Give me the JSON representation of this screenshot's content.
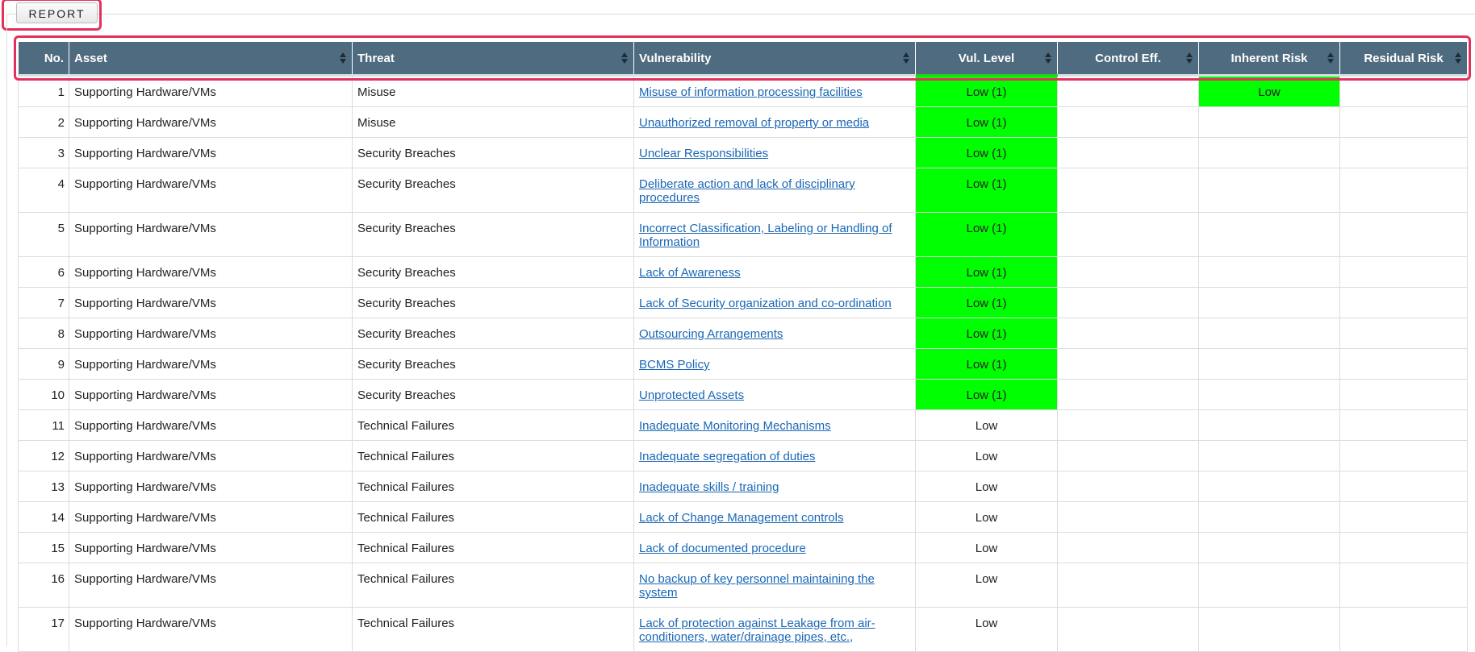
{
  "toolbar": {
    "report_label": "REPORT"
  },
  "table": {
    "headers": {
      "no": "No.",
      "asset": "Asset",
      "threat": "Threat",
      "vulnerability": "Vulnerability",
      "vul_level": "Vul. Level",
      "control_eff": "Control Eff.",
      "inherent_risk": "Inherent Risk",
      "residual_risk": "Residual Risk"
    },
    "colors": {
      "header_bg": "#4f6b7f",
      "level_low_bg": "#00ff00",
      "link": "#1a67b5",
      "highlight": "#e0325a"
    },
    "rows": [
      {
        "no": "1",
        "asset": "Supporting Hardware/VMs",
        "threat": "Misuse",
        "vulnerability": "Misuse of information processing facilities",
        "vul_level": "Low (1)",
        "control_eff": "",
        "inherent_risk": "Low",
        "residual_risk": ""
      },
      {
        "no": "2",
        "asset": "Supporting Hardware/VMs",
        "threat": "Misuse",
        "vulnerability": "Unauthorized removal of property or media",
        "vul_level": "Low (1)",
        "control_eff": "",
        "inherent_risk": "",
        "residual_risk": ""
      },
      {
        "no": "3",
        "asset": "Supporting Hardware/VMs",
        "threat": "Security Breaches",
        "vulnerability": "Unclear Responsibilities",
        "vul_level": "Low (1)",
        "control_eff": "",
        "inherent_risk": "",
        "residual_risk": ""
      },
      {
        "no": "4",
        "asset": "Supporting Hardware/VMs",
        "threat": "Security Breaches",
        "vulnerability": "Deliberate action and lack of disciplinary procedures",
        "vul_level": "Low (1)",
        "control_eff": "",
        "inherent_risk": "",
        "residual_risk": ""
      },
      {
        "no": "5",
        "asset": "Supporting Hardware/VMs",
        "threat": "Security Breaches",
        "vulnerability": "Incorrect Classification, Labeling or Handling of Information",
        "vul_level": "Low (1)",
        "control_eff": "",
        "inherent_risk": "",
        "residual_risk": ""
      },
      {
        "no": "6",
        "asset": "Supporting Hardware/VMs",
        "threat": "Security Breaches",
        "vulnerability": "Lack of Awareness",
        "vul_level": "Low (1)",
        "control_eff": "",
        "inherent_risk": "",
        "residual_risk": ""
      },
      {
        "no": "7",
        "asset": "Supporting Hardware/VMs",
        "threat": "Security Breaches",
        "vulnerability": "Lack of Security organization and co-ordination",
        "vul_level": "Low (1)",
        "control_eff": "",
        "inherent_risk": "",
        "residual_risk": ""
      },
      {
        "no": "8",
        "asset": "Supporting Hardware/VMs",
        "threat": "Security Breaches",
        "vulnerability": "Outsourcing Arrangements",
        "vul_level": "Low (1)",
        "control_eff": "",
        "inherent_risk": "",
        "residual_risk": ""
      },
      {
        "no": "9",
        "asset": "Supporting Hardware/VMs",
        "threat": "Security Breaches",
        "vulnerability": "BCMS Policy",
        "vul_level": "Low (1)",
        "control_eff": "",
        "inherent_risk": "",
        "residual_risk": ""
      },
      {
        "no": "10",
        "asset": "Supporting Hardware/VMs",
        "threat": "Security Breaches",
        "vulnerability": "Unprotected Assets",
        "vul_level": "Low (1)",
        "control_eff": "",
        "inherent_risk": "",
        "residual_risk": ""
      },
      {
        "no": "11",
        "asset": "Supporting Hardware/VMs",
        "threat": "Technical Failures",
        "vulnerability": "Inadequate Monitoring Mechanisms",
        "vul_level": "Low",
        "control_eff": "",
        "inherent_risk": "",
        "residual_risk": ""
      },
      {
        "no": "12",
        "asset": "Supporting Hardware/VMs",
        "threat": "Technical Failures",
        "vulnerability": "Inadequate segregation of duties",
        "vul_level": "Low",
        "control_eff": "",
        "inherent_risk": "",
        "residual_risk": ""
      },
      {
        "no": "13",
        "asset": "Supporting Hardware/VMs",
        "threat": "Technical Failures",
        "vulnerability": "Inadequate skills / training",
        "vul_level": "Low",
        "control_eff": "",
        "inherent_risk": "",
        "residual_risk": ""
      },
      {
        "no": "14",
        "asset": "Supporting Hardware/VMs",
        "threat": "Technical Failures",
        "vulnerability": "Lack of Change Management controls",
        "vul_level": "Low",
        "control_eff": "",
        "inherent_risk": "",
        "residual_risk": ""
      },
      {
        "no": "15",
        "asset": "Supporting Hardware/VMs",
        "threat": "Technical Failures",
        "vulnerability": "Lack of documented procedure",
        "vul_level": "Low",
        "control_eff": "",
        "inherent_risk": "",
        "residual_risk": ""
      },
      {
        "no": "16",
        "asset": "Supporting Hardware/VMs",
        "threat": "Technical Failures",
        "vulnerability": "No backup of key personnel maintaining the system",
        "vul_level": "Low",
        "control_eff": "",
        "inherent_risk": "",
        "residual_risk": ""
      },
      {
        "no": "17",
        "asset": "Supporting Hardware/VMs",
        "threat": "Technical Failures",
        "vulnerability": "Lack of protection against Leakage from air-conditioners, water/drainage pipes, etc.,",
        "vul_level": "Low",
        "control_eff": "",
        "inherent_risk": "",
        "residual_risk": ""
      }
    ]
  }
}
